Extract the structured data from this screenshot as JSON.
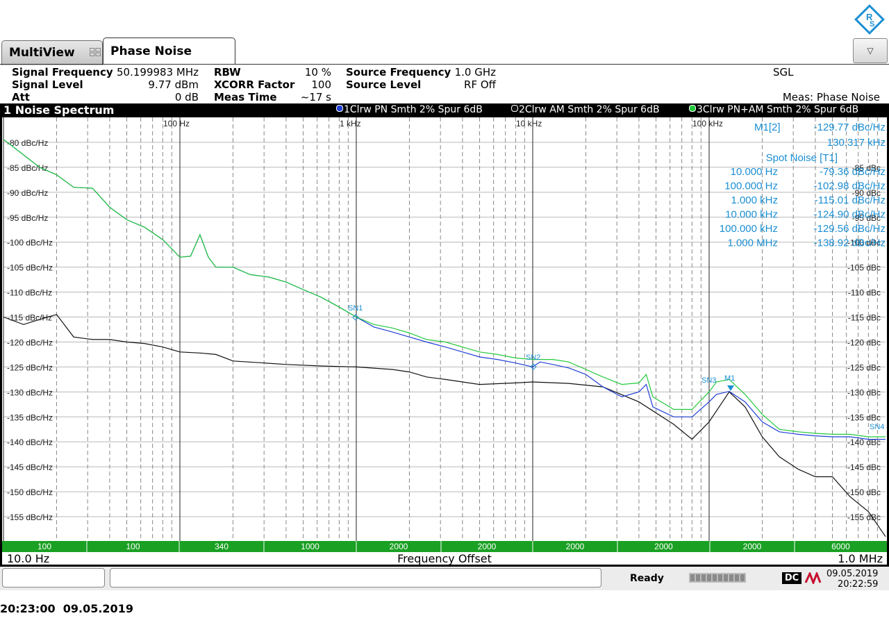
{
  "tabs": {
    "multiview": "MultiView",
    "phase_noise": "Phase Noise"
  },
  "info": {
    "signal_frequency_label": "Signal Frequency",
    "signal_frequency": "50.199983 MHz",
    "signal_level_label": "Signal Level",
    "signal_level": "9.77 dBm",
    "att_label": "Att",
    "att": "0 dB",
    "rbw_label": "RBW",
    "rbw": "10 %",
    "xcorr_label": "XCORR Factor",
    "xcorr": "100",
    "meas_time_label": "Meas Time",
    "meas_time": "~17 s",
    "source_frequency_label": "Source Frequency",
    "source_frequency": "1.0 GHz",
    "source_level_label": "Source Level",
    "source_level": "RF Off",
    "sgl": "SGL",
    "meas": "Meas: Phase Noise"
  },
  "window": {
    "title": "1 Noise Spectrum",
    "traces": [
      {
        "label": "1Clrw PN Smth 2% Spur 6dB",
        "color": "#1f3fd6"
      },
      {
        "label": "2Clrw AM Smth 2% Spur 6dB",
        "color": "#111111"
      },
      {
        "label": "3Clrw PN+AM Smth 2% Spur 6dB",
        "color": "#22c93a"
      }
    ]
  },
  "marker_info": {
    "m1_label": "M1[2]",
    "m1_value": "-129.77 dBc/Hz",
    "m1_freq": "130.317 kHz",
    "spot_title": "Spot Noise [T1]",
    "spot": [
      {
        "f": "10.000 Hz",
        "v": "-79.36 dBc/Hz"
      },
      {
        "f": "100.000 Hz",
        "v": "-102.98 dBc/Hz"
      },
      {
        "f": "1.000 kHz",
        "v": "-115.01 dBc/Hz"
      },
      {
        "f": "10.000 kHz",
        "v": "-124.90 dBc/Hz"
      },
      {
        "f": "100.000 kHz",
        "v": "-129.56 dBc/Hz"
      },
      {
        "f": "1.000 MHz",
        "v": "-138.92 dBc/Hz"
      }
    ]
  },
  "axis": {
    "decade_labels": [
      "100 Hz",
      "1 kHz",
      "10 kHz",
      "100 kHz"
    ],
    "left_labels": [
      "-80 dBc/Hz",
      "-85 dBc/Hz",
      "-90 dBc/Hz",
      "-95 dBc/Hz",
      "-100 dBc/Hz",
      "-105 dBc/Hz",
      "-110 dBc/Hz",
      "-115 dBc/Hz",
      "-120 dBc/Hz",
      "-125 dBc/Hz",
      "-130 dBc/Hz",
      "-135 dBc/Hz",
      "-140 dBc/Hz",
      "-145 dBc/Hz",
      "-150 dBc/Hz",
      "-155 dBc/Hz"
    ],
    "right_labels": [
      "-85 dBc",
      "-90 dBc",
      "-95 dBc",
      "-100 dBc",
      "-105 dBc",
      "-110 dBc",
      "-115 dBc",
      "-120 dBc",
      "-125 dBc",
      "-130 dBc",
      "-135 dBc",
      "-140 dBc",
      "-145 dBc",
      "-150 dBc",
      "-155 dBc"
    ],
    "start": "10.0 Hz",
    "center": "Frequency Offset",
    "stop": "1.0 MHz",
    "averages": [
      "100",
      "100",
      "340",
      "1000",
      "2000",
      "2000",
      "2000",
      "2000",
      "2000",
      "6000"
    ]
  },
  "markers": {
    "sn1": "SN1",
    "sn2": "SN2",
    "sn3": "SN3",
    "sn4": "SN4",
    "m1": "M1"
  },
  "status": {
    "ready": "Ready",
    "dc": "DC",
    "date": "09.05.2019",
    "time": "20:22:59",
    "footer": "20:23:00  09.05.2019"
  },
  "chart_data": {
    "type": "line",
    "xscale": "log",
    "xlim": [
      10,
      1000000
    ],
    "ylim": [
      -160,
      -75
    ],
    "ylabel": "dBc/Hz",
    "xlabel": "Frequency Offset",
    "series": [
      {
        "color": "#1f3fd6",
        "points": [
          [
            10,
            -79.4
          ],
          [
            13,
            -82.5
          ],
          [
            16,
            -85
          ],
          [
            20,
            -86.5
          ],
          [
            25,
            -89
          ],
          [
            32,
            -89.2
          ],
          [
            40,
            -93
          ],
          [
            50,
            -95.5
          ],
          [
            63,
            -97
          ],
          [
            80,
            -99.5
          ],
          [
            100,
            -103
          ],
          [
            115,
            -102.8
          ],
          [
            130,
            -98.5
          ],
          [
            145,
            -103
          ],
          [
            160,
            -105
          ],
          [
            200,
            -105
          ],
          [
            250,
            -106.5
          ],
          [
            320,
            -107
          ],
          [
            400,
            -108
          ],
          [
            500,
            -109.5
          ],
          [
            630,
            -111
          ],
          [
            800,
            -113
          ],
          [
            1000,
            -115
          ],
          [
            1260,
            -117
          ],
          [
            1600,
            -118
          ],
          [
            2000,
            -119
          ],
          [
            2500,
            -120
          ],
          [
            3200,
            -121
          ],
          [
            4000,
            -122
          ],
          [
            5000,
            -123
          ],
          [
            6300,
            -123.5
          ],
          [
            8000,
            -124.2
          ],
          [
            10000,
            -125
          ],
          [
            11000,
            -124
          ],
          [
            13000,
            -124.5
          ],
          [
            16000,
            -125.2
          ],
          [
            20000,
            -126.5
          ],
          [
            25000,
            -129
          ],
          [
            32000,
            -131
          ],
          [
            40000,
            -130
          ],
          [
            44000,
            -128.5
          ],
          [
            48000,
            -133
          ],
          [
            63000,
            -135
          ],
          [
            80000,
            -135
          ],
          [
            100000,
            -132
          ],
          [
            110000,
            -130.5
          ],
          [
            130000,
            -129.9
          ],
          [
            160000,
            -132
          ],
          [
            200000,
            -136
          ],
          [
            250000,
            -138
          ],
          [
            320000,
            -138.5
          ],
          [
            400000,
            -138.8
          ],
          [
            500000,
            -139
          ],
          [
            630000,
            -139
          ],
          [
            800000,
            -139.5
          ],
          [
            1000000,
            -139.5
          ]
        ]
      },
      {
        "color": "#111111",
        "points": [
          [
            10,
            -115
          ],
          [
            13,
            -116.5
          ],
          [
            16,
            -115.5
          ],
          [
            20,
            -114.5
          ],
          [
            25,
            -119
          ],
          [
            32,
            -119.5
          ],
          [
            40,
            -119.5
          ],
          [
            50,
            -120
          ],
          [
            63,
            -120.3
          ],
          [
            80,
            -121
          ],
          [
            100,
            -122
          ],
          [
            130,
            -122.2
          ],
          [
            160,
            -122.5
          ],
          [
            200,
            -123.8
          ],
          [
            300,
            -124.2
          ],
          [
            400,
            -124.5
          ],
          [
            630,
            -124.8
          ],
          [
            1000,
            -125
          ],
          [
            1600,
            -125.5
          ],
          [
            2000,
            -126
          ],
          [
            2500,
            -127
          ],
          [
            3200,
            -127.5
          ],
          [
            5000,
            -128.5
          ],
          [
            8000,
            -128.2
          ],
          [
            10000,
            -128
          ],
          [
            16000,
            -128.3
          ],
          [
            25000,
            -129
          ],
          [
            40000,
            -132
          ],
          [
            63000,
            -136.5
          ],
          [
            80000,
            -139.5
          ],
          [
            100000,
            -136
          ],
          [
            130000,
            -130
          ],
          [
            160000,
            -133
          ],
          [
            200000,
            -139
          ],
          [
            250000,
            -143
          ],
          [
            320000,
            -145.5
          ],
          [
            400000,
            -147
          ],
          [
            500000,
            -147
          ],
          [
            630000,
            -151
          ],
          [
            800000,
            -154
          ],
          [
            1000000,
            -159
          ]
        ]
      },
      {
        "color": "#22c93a",
        "points": [
          [
            10,
            -79.4
          ],
          [
            13,
            -82.5
          ],
          [
            16,
            -85
          ],
          [
            20,
            -86.5
          ],
          [
            25,
            -89
          ],
          [
            32,
            -89.2
          ],
          [
            40,
            -93
          ],
          [
            50,
            -95.5
          ],
          [
            63,
            -97
          ],
          [
            80,
            -99.5
          ],
          [
            100,
            -103
          ],
          [
            115,
            -102.8
          ],
          [
            130,
            -98.5
          ],
          [
            145,
            -103
          ],
          [
            160,
            -105
          ],
          [
            200,
            -105
          ],
          [
            250,
            -106.5
          ],
          [
            320,
            -107
          ],
          [
            400,
            -108
          ],
          [
            500,
            -109.5
          ],
          [
            630,
            -111
          ],
          [
            800,
            -113
          ],
          [
            1000,
            -115
          ],
          [
            1260,
            -116.5
          ],
          [
            1600,
            -117.2
          ],
          [
            2000,
            -118.2
          ],
          [
            2500,
            -119.5
          ],
          [
            3200,
            -120
          ],
          [
            4000,
            -121
          ],
          [
            5000,
            -122
          ],
          [
            6300,
            -122.5
          ],
          [
            8000,
            -123.2
          ],
          [
            10000,
            -123.5
          ],
          [
            13000,
            -123.5
          ],
          [
            16000,
            -124
          ],
          [
            20000,
            -125.5
          ],
          [
            25000,
            -127
          ],
          [
            32000,
            -128.5
          ],
          [
            40000,
            -128.2
          ],
          [
            44000,
            -126.5
          ],
          [
            48000,
            -131
          ],
          [
            63000,
            -133.5
          ],
          [
            80000,
            -133.5
          ],
          [
            100000,
            -130
          ],
          [
            110000,
            -128
          ],
          [
            130000,
            -127.5
          ],
          [
            160000,
            -130.5
          ],
          [
            200000,
            -134.5
          ],
          [
            250000,
            -137.5
          ],
          [
            320000,
            -138
          ],
          [
            400000,
            -138.3
          ],
          [
            500000,
            -138.5
          ],
          [
            630000,
            -138.5
          ],
          [
            800000,
            -139
          ],
          [
            1000000,
            -139
          ]
        ]
      }
    ]
  }
}
